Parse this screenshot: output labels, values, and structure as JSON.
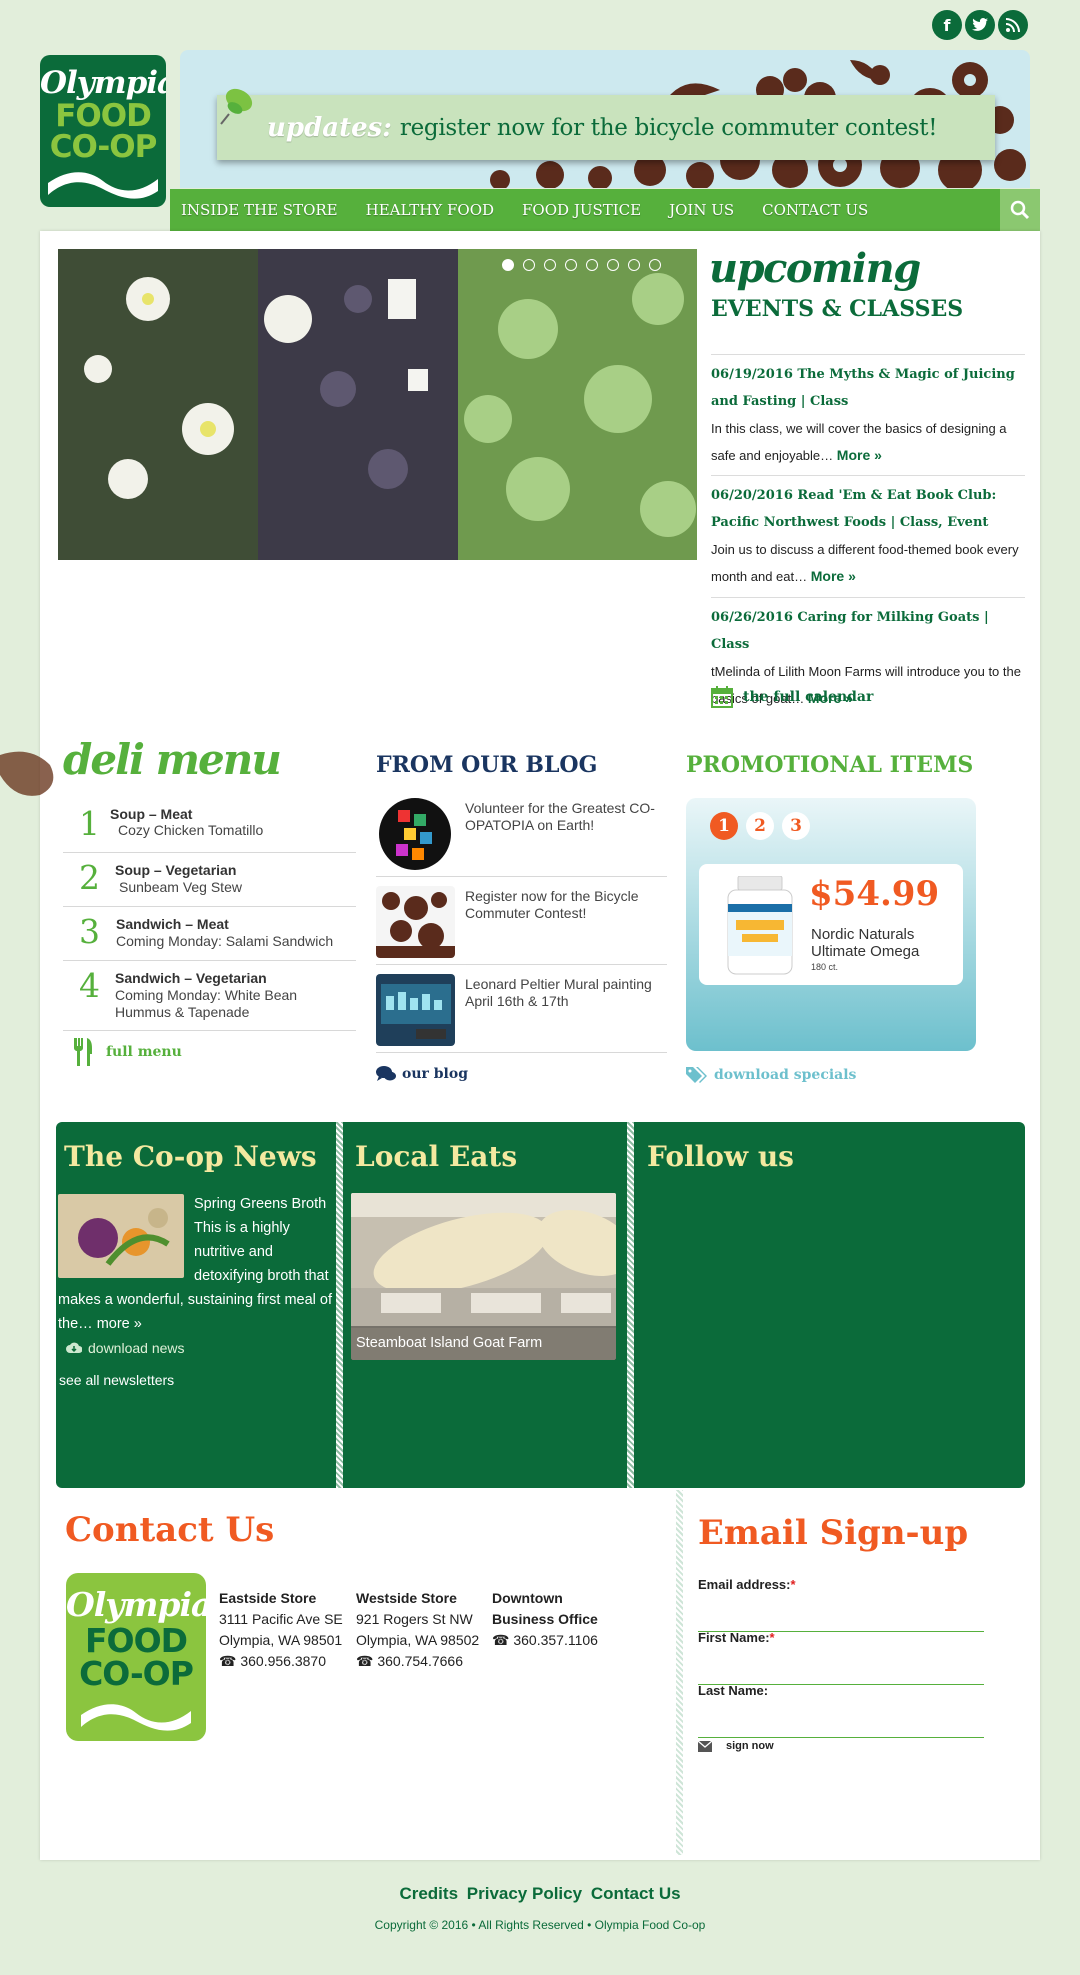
{
  "colors": {
    "dark_green": "#0b6b3a",
    "light_green": "#56b03c",
    "orange": "#f05a22",
    "teal": "#6dc0cd",
    "navy": "#1a3560",
    "bg": "#e2eedb"
  },
  "social": {
    "facebook": "f",
    "twitter": "t",
    "rss": "rss"
  },
  "logo": {
    "line1": "Olympia",
    "line2": "FOOD",
    "line3": "CO-OP"
  },
  "updates": {
    "label": "updates:",
    "text": "register now for the bicycle commuter contest!"
  },
  "nav": [
    "INSIDE THE STORE",
    "HEALTHY FOOD",
    "FOOD JUSTICE",
    "JOIN US",
    "CONTACT US"
  ],
  "slider": {
    "slides": 8,
    "active": 1
  },
  "events": {
    "heading1": "upcoming",
    "heading2": "EVENTS & CLASSES",
    "items": [
      {
        "title": "06/19/2016 The Myths & Magic of Juicing and Fasting | Class",
        "desc": "In this class, we will cover the basics of designing a safe and enjoyable…",
        "more": "More »"
      },
      {
        "title": "06/20/2016 Read 'Em & Eat Book Club: Pacific Northwest Foods | Class, Event",
        "desc": "Join us to discuss a different food-themed book every month and eat…",
        "more": "More »"
      },
      {
        "title": "06/26/2016 Caring for Milking Goats | Class",
        "desc": "tMelinda of Lilith Moon Farms will introduce you to the basics of goat…",
        "more": "More »"
      }
    ],
    "calendar_link": "the full calendar"
  },
  "deli": {
    "heading": "deli menu",
    "items": [
      {
        "num": "1",
        "category": "Soup – Meat",
        "item": "Cozy Chicken Tomatillo"
      },
      {
        "num": "2",
        "category": "Soup – Vegetarian",
        "item": "Sunbeam Veg Stew"
      },
      {
        "num": "3",
        "category": "Sandwich – Meat",
        "item": "Coming Monday: Salami Sandwich"
      },
      {
        "num": "4",
        "category": "Sandwich – Vegetarian",
        "item": "Coming Monday: White Bean Hummus & Tapenade"
      }
    ],
    "full_menu": "full menu"
  },
  "blog": {
    "heading": "FROM OUR BLOG",
    "items": [
      {
        "text": "Volunteer for the Greatest CO-OPATOPIA on Earth!"
      },
      {
        "text": "Register now for the Bicycle Commuter Contest!"
      },
      {
        "text": "Leonard Peltier Mural painting April 16th & 17th"
      }
    ],
    "link": "our blog"
  },
  "promo": {
    "heading": "PROMOTIONAL ITEMS",
    "pages": [
      "1",
      "2",
      "3"
    ],
    "active_page": "1",
    "price": "$54.99",
    "name": "Nordic Naturals Ultimate Omega",
    "count": "180 ct.",
    "download": "download specials"
  },
  "news": {
    "heading": "The Co-op News",
    "title": "Spring Greens Broth",
    "body": "This is a highly nutritive and detoxifying broth that makes a wonderful, sustaining first meal of the…",
    "more": "more »",
    "download": "download news",
    "see_all": "see all newsletters"
  },
  "local_eats": {
    "heading": "Local Eats",
    "caption": "Steamboat Island Goat Farm"
  },
  "follow": {
    "heading": "Follow us"
  },
  "contact": {
    "heading": "Contact Us",
    "stores": [
      {
        "name": "Eastside Store",
        "lines": [
          "3111 Pacific Ave SE",
          "Olympia, WA 98501"
        ],
        "phone": "360.956.3870"
      },
      {
        "name": "Westside Store",
        "lines": [
          "921 Rogers St NW",
          "Olympia, WA 98502"
        ],
        "phone": "360.754.7666"
      },
      {
        "name": "Downtown Business Office",
        "lines": [],
        "phone": "360.357.1106"
      }
    ]
  },
  "signup": {
    "heading": "Email Sign-up",
    "email_label": "Email address:",
    "first_label": "First Name:",
    "last_label": "Last Name:",
    "required": "*",
    "button": "sign now"
  },
  "footer": {
    "links": [
      "Credits",
      "Privacy Policy",
      "Contact Us"
    ],
    "copyright": "Copyright © 2016 • All Rights Reserved • Olympia Food Co-op"
  }
}
